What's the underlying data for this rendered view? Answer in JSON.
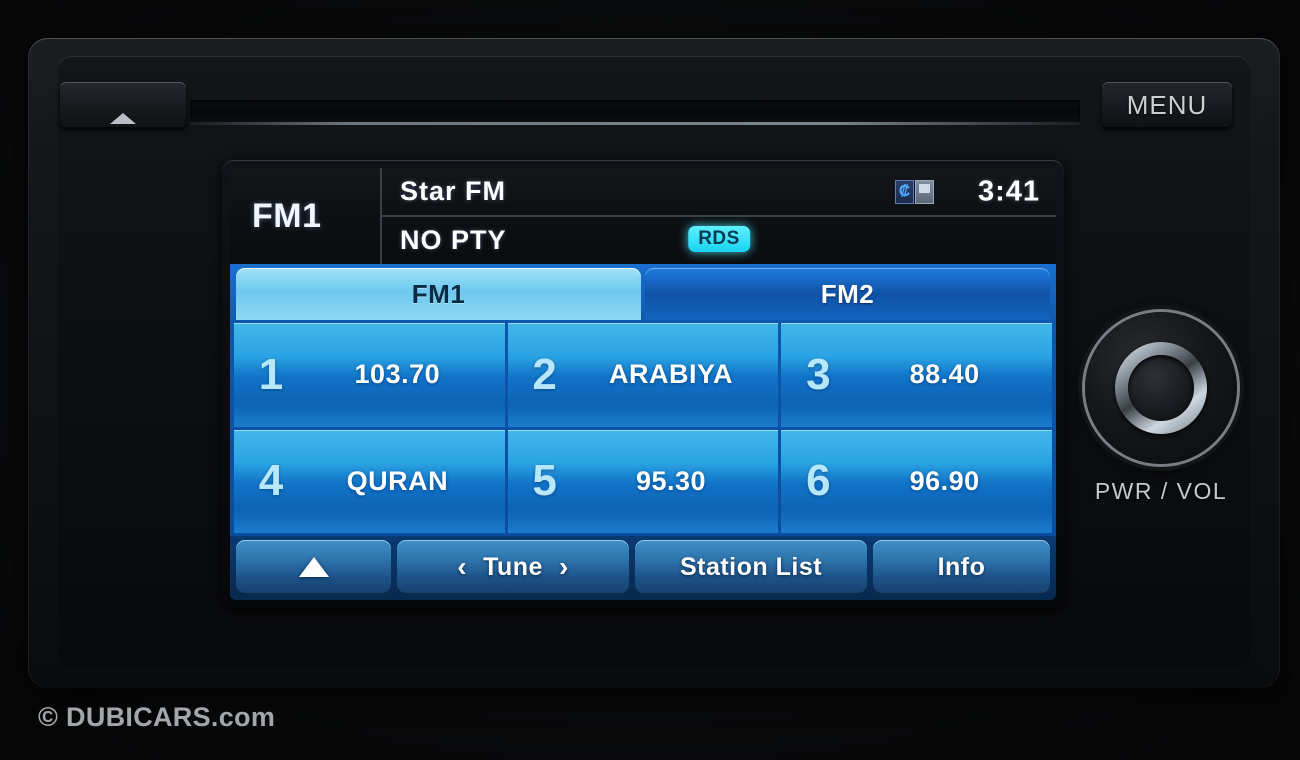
{
  "device": {
    "faceplate": {
      "eject_button": {
        "icon": "eject-icon"
      },
      "menu_button_label": "MENU",
      "cd_slot": ""
    },
    "knob": {
      "label": "PWR / VOL"
    }
  },
  "display": {
    "header": {
      "band": "FM1",
      "station_name": "Star  FM",
      "pty": "NO PTY",
      "rds_badge": "RDS",
      "clock": "3:41",
      "icons": [
        "bluetooth-icon",
        "phone-signal-icon"
      ]
    },
    "tabs": [
      {
        "label": "FM1",
        "active": true
      },
      {
        "label": "FM2",
        "active": false
      }
    ],
    "presets": [
      {
        "number": "1",
        "label": "103.70"
      },
      {
        "number": "2",
        "label": "ARABIYA"
      },
      {
        "number": "3",
        "label": "88.40"
      },
      {
        "number": "4",
        "label": "QURAN"
      },
      {
        "number": "5",
        "label": "95.30"
      },
      {
        "number": "6",
        "label": "96.90"
      }
    ],
    "buttons": {
      "scroll_up": "",
      "tune": "Tune",
      "tune_prev": "‹",
      "tune_next": "›",
      "station_list": "Station List",
      "info": "Info"
    }
  },
  "watermark": {
    "symbol": "©",
    "text": "DUBICARS.com"
  },
  "colors": {
    "accent_cyan": "#5ff0ff",
    "tab_active": "#8ed9f4",
    "tab_inactive": "#1464bd",
    "preset_blue": "#1173c8",
    "text_white": "#ffffff"
  }
}
